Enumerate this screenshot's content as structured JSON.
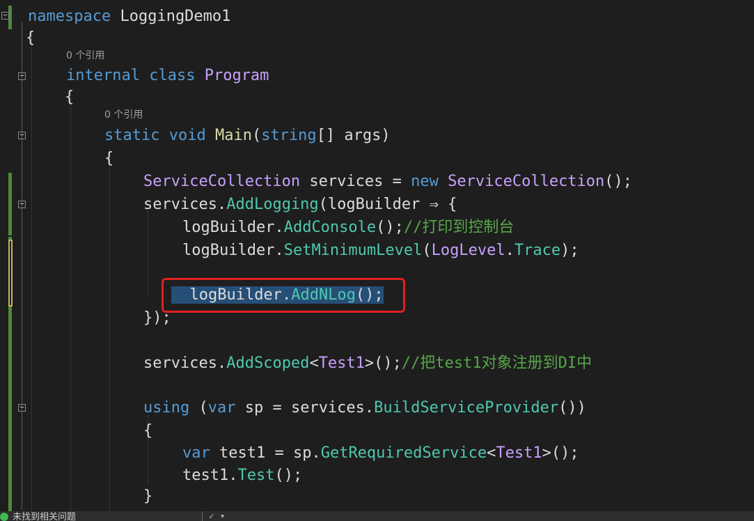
{
  "editor": {
    "lines": {
      "namespace_kw": "namespace",
      "namespace_name": "LoggingDemo1",
      "open_brace": "{",
      "close_brace": "}",
      "refs": "0 个引用",
      "internal_kw": "internal",
      "class_kw": "class",
      "class_name": "Program",
      "static_kw": "static",
      "void_kw": "void",
      "main_name": "Main",
      "paren_open": "(",
      "string_kw": "string",
      "array_args": "[] args",
      "paren_close": ")",
      "svc_type": "ServiceCollection",
      "svc_var": " services = ",
      "new_kw": "new",
      "svc_ctor": "ServiceCollection",
      "call_end": "();",
      "services_dot": "services.",
      "add_logging": "AddLogging",
      "lambda_head": "(logBuilder ⇒ {",
      "logbuilder_dot": "logBuilder.",
      "add_console": "AddConsole",
      "comment_console": "//打印到控制台",
      "set_min_level": "SetMinimumLevel",
      "loglevel_type": "LogLevel",
      "dot": ".",
      "trace": "Trace",
      "tail_paren_semicolon": ");",
      "add_nlog": "AddNLog",
      "lambda_close": "});",
      "add_scoped": "AddScoped",
      "lt": "<",
      "test1_type": "Test1",
      "gt_call": ">();",
      "comment_scoped": "//把test1对象注册到DI中",
      "using_kw": "using",
      "open_paren_space": " (",
      "var_kw": "var",
      "sp_assign": " sp = services.",
      "build_sp": "BuildServiceProvider",
      "build_tail": "())",
      "test1_assign": " test1 = sp.",
      "get_required": "GetRequiredService",
      "test1_call_prefix": "test1.",
      "test_method": "Test"
    }
  },
  "statusbar": {
    "issues_text": "未找到相关问题",
    "tool_glyph": "✓ ▾"
  },
  "colors": {
    "background": "#1e1e1e",
    "keyword": "#569cd6",
    "type": "#4ec9b0",
    "method": "#dcdcaa",
    "comment": "#57a64a",
    "selection": "#264f78",
    "highlight_box": "#e02020",
    "change_bar": "#4e8a3a"
  }
}
